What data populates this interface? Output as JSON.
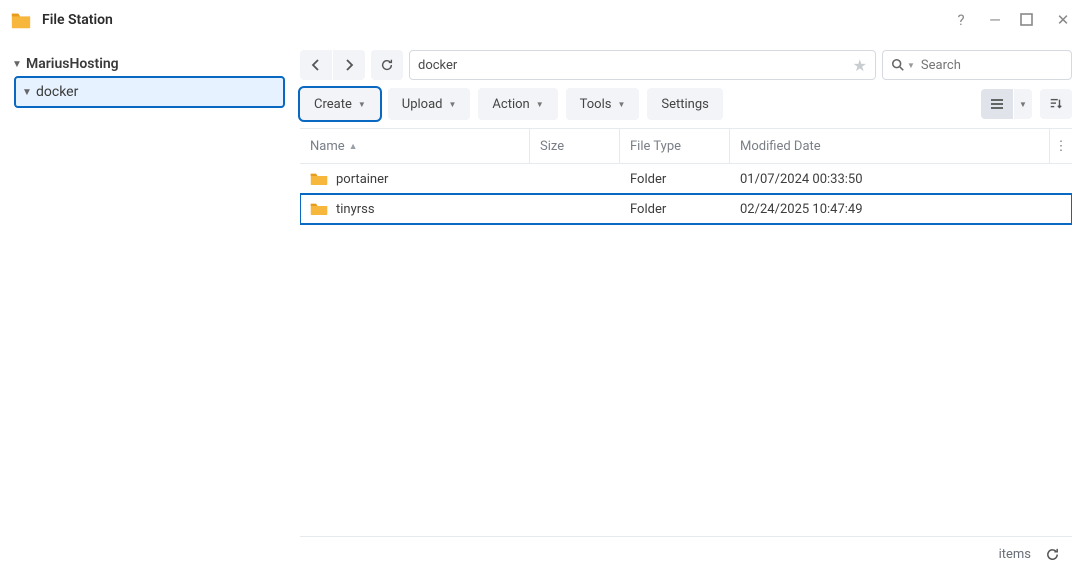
{
  "app": {
    "title": "File Station"
  },
  "sidebar": {
    "root": "MariusHosting",
    "items": [
      {
        "label": "docker",
        "selected": true
      }
    ]
  },
  "toolbar": {
    "path": "docker",
    "search_placeholder": "Search"
  },
  "actions": {
    "create": "Create",
    "upload": "Upload",
    "action": "Action",
    "tools": "Tools",
    "settings": "Settings"
  },
  "columns": {
    "name": "Name",
    "size": "Size",
    "type": "File Type",
    "date": "Modified Date"
  },
  "rows": [
    {
      "name": "portainer",
      "size": "",
      "type": "Folder",
      "date": "01/07/2024 00:33:50",
      "highlight": false
    },
    {
      "name": "tinyrss",
      "size": "",
      "type": "Folder",
      "date": "02/24/2025 10:47:49",
      "highlight": true
    }
  ],
  "footer": {
    "items_label": "items"
  }
}
